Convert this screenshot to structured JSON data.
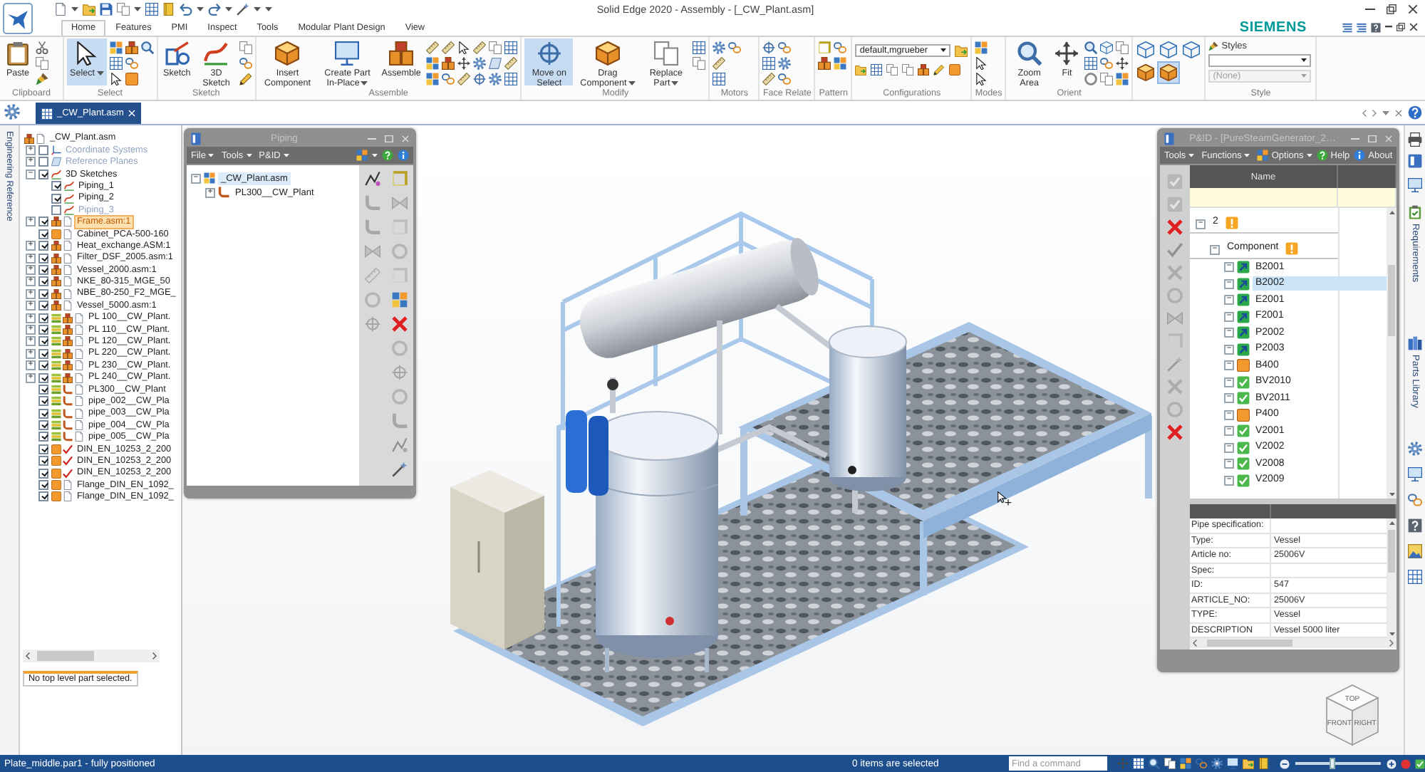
{
  "app": {
    "title": "Solid Edge 2020 - Assembly - [_CW_Plant.asm]",
    "brand": "SIEMENS"
  },
  "ribbon_tabs": [
    {
      "label": "Home",
      "selected": true
    },
    {
      "label": "Features",
      "selected": false
    },
    {
      "label": "PMI",
      "selected": false
    },
    {
      "label": "Inspect",
      "selected": false
    },
    {
      "label": "Tools",
      "selected": false
    },
    {
      "label": "Modular Plant Design",
      "selected": false
    },
    {
      "label": "View",
      "selected": false
    }
  ],
  "ribbon_groups": [
    {
      "kind": "clipboard",
      "label": "Clipboard",
      "commands": [
        {
          "label": "Paste",
          "selected": false,
          "dropdown": false
        }
      ]
    },
    {
      "kind": "select",
      "label": "Select",
      "commands": [
        {
          "label": "Select",
          "selected": true,
          "dropdown": true
        }
      ]
    },
    {
      "kind": "sketch",
      "label": "Sketch",
      "commands": [
        {
          "label": "Sketch",
          "selected": false,
          "dropdown": false
        },
        {
          "label": "3D Sketch",
          "selected": false,
          "dropdown": false
        }
      ]
    },
    {
      "kind": "assemble",
      "label": "Assemble",
      "commands": [
        {
          "label": "Insert Component",
          "selected": false,
          "dropdown": false
        },
        {
          "label": "Create Part In-Place",
          "selected": false,
          "dropdown": true
        },
        {
          "label": "Assemble",
          "selected": false,
          "dropdown": false
        }
      ]
    },
    {
      "kind": "modify",
      "label": "Modify",
      "commands": [
        {
          "label": "Move on Select",
          "selected": true,
          "dropdown": false
        },
        {
          "label": "Drag Component",
          "selected": false,
          "dropdown": true
        },
        {
          "label": "Replace Part",
          "selected": false,
          "dropdown": true
        }
      ]
    },
    {
      "kind": "motors",
      "label": "Motors"
    },
    {
      "kind": "relate",
      "label": "Face Relate"
    },
    {
      "kind": "pattern",
      "label": "Pattern"
    },
    {
      "kind": "configurations",
      "label": "Configurations",
      "dropdowns": [
        {
          "value": "default,mgrueber",
          "disabled": false
        }
      ]
    },
    {
      "kind": "modes",
      "label": "Modes"
    },
    {
      "kind": "orient",
      "label": "Orient",
      "commands": [
        {
          "label": "Zoom Area",
          "selected": false,
          "dropdown": false
        },
        {
          "label": "Fit",
          "selected": false,
          "dropdown": false
        }
      ]
    },
    {
      "kind": "views",
      "styles": [
        {
          "selected": false
        },
        {
          "selected": false
        },
        {
          "selected": false
        },
        {
          "selected": false
        },
        {
          "selected": true
        }
      ]
    },
    {
      "kind": "style",
      "label": "Style",
      "heading": "Styles",
      "dropdowns": [
        {
          "disabled": false
        },
        {
          "value": "(None)",
          "disabled": true
        }
      ]
    }
  ],
  "document_tabs": [
    {
      "label": "_CW_Plant.asm",
      "selected": true
    }
  ],
  "side_tabs_left": [
    {
      "label": "Engineering Reference",
      "selected": false
    }
  ],
  "assembly_tree": {
    "root": {
      "label": "_CW_Plant.asm",
      "kind": "assembly",
      "children": [
        {
          "label": "Coordinate Systems",
          "kind": "coordinates",
          "toggle": "+",
          "checked": false,
          "selected": false
        },
        {
          "label": "Reference Planes",
          "kind": "planes",
          "toggle": "+",
          "checked": false,
          "selected": false
        },
        {
          "label": "3D Sketches",
          "kind": "sketches",
          "toggle": "−",
          "checked": true,
          "selected": false,
          "children": [
            {
              "label": "Piping_1",
              "kind": "sketch",
              "checked": true,
              "selected": false
            },
            {
              "label": "Piping_2",
              "kind": "sketch",
              "checked": true,
              "selected": false
            },
            {
              "label": "Piping_3",
              "kind": "sketch",
              "checked": false,
              "selected": false
            }
          ]
        },
        {
          "label": "Frame.asm:1",
          "kind": "assembly",
          "toggle": "+",
          "checked": true,
          "selected": true
        },
        {
          "label": "Cabinet_PCA-500-160",
          "kind": "part",
          "checked": true,
          "selected": false
        },
        {
          "label": "Heat_exchange.ASM:1",
          "kind": "assembly",
          "toggle": "+",
          "checked": true,
          "selected": false
        },
        {
          "label": "Filter_DSF_2005.asm:1",
          "kind": "assembly",
          "toggle": "+",
          "checked": true,
          "selected": false
        },
        {
          "label": "Vessel_2000.asm:1",
          "kind": "assembly",
          "toggle": "+",
          "checked": true,
          "selected": false
        },
        {
          "label": "NKE_80-315_MGE_50",
          "kind": "assembly",
          "toggle": "+",
          "checked": true,
          "selected": false
        },
        {
          "label": "NBE_80-250_F2_MGE_",
          "kind": "assembly",
          "toggle": "+",
          "checked": true,
          "selected": false
        },
        {
          "label": "Vessel_5000.asm:1",
          "kind": "assembly",
          "toggle": "+",
          "checked": true,
          "selected": false
        },
        {
          "label": "PL 100__CW_Plant.",
          "kind": "pipeline",
          "toggle": "+",
          "checked": true,
          "selected": false
        },
        {
          "label": "PL 110__CW_Plant.",
          "kind": "pipeline",
          "toggle": "+",
          "checked": true,
          "selected": false
        },
        {
          "label": "PL 120__CW_Plant.",
          "kind": "pipeline",
          "toggle": "+",
          "checked": true,
          "selected": false
        },
        {
          "label": "PL 220__CW_Plant.",
          "kind": "pipeline",
          "toggle": "+",
          "checked": true,
          "selected": false
        },
        {
          "label": "PL 230__CW_Plant.",
          "kind": "pipeline",
          "toggle": "+",
          "checked": true,
          "selected": false
        },
        {
          "label": "PL 240__CW_Plant.",
          "kind": "pipeline",
          "toggle": "+",
          "checked": true,
          "selected": false
        },
        {
          "label": "PL300__CW_Plant",
          "kind": "route",
          "checked": true,
          "selected": false
        },
        {
          "label": "pipe_002__CW_Pla",
          "kind": "route",
          "checked": true,
          "selected": false
        },
        {
          "label": "pipe_003__CW_Pla",
          "kind": "route",
          "checked": true,
          "selected": false
        },
        {
          "label": "pipe_004__CW_Pla",
          "kind": "route",
          "checked": true,
          "selected": false
        },
        {
          "label": "pipe_005__CW_Pla",
          "kind": "route",
          "checked": true,
          "selected": false
        },
        {
          "label": "DIN_EN_10253_2_200",
          "kind": "fitting",
          "checked": true,
          "selected": false
        },
        {
          "label": "DIN_EN_10253_2_200",
          "kind": "fitting",
          "checked": true,
          "selected": false
        },
        {
          "label": "DIN_EN_10253_2_200",
          "kind": "fitting",
          "checked": true,
          "selected": false
        },
        {
          "label": "Flange_DIN_EN_1092_",
          "kind": "part",
          "checked": true,
          "selected": false
        },
        {
          "label": "Flange_DIN_EN_1092_",
          "kind": "part",
          "checked": true,
          "selected": false
        }
      ]
    },
    "status": "No top level part selected."
  },
  "piping_panel": {
    "title": "Piping",
    "menus": [
      "File",
      "Tools",
      "P&ID"
    ],
    "tree": [
      {
        "label": "_CW_Plant.asm",
        "kind": "assembly",
        "toggle": "−",
        "selected": true,
        "children": [
          {
            "label": "PL300__CW_Plant",
            "kind": "pipeline",
            "toggle": "+",
            "selected": false
          }
        ]
      }
    ]
  },
  "pid_panel": {
    "title": "P&ID - [PureSteamGenerator_2…",
    "menus": [
      "Tools",
      "Functions"
    ],
    "actions": [
      "Options",
      "Help",
      "About"
    ],
    "column": "Name",
    "tree": [
      {
        "label": "2",
        "kind": "group",
        "toggle": "−",
        "selected": false,
        "children": [
          {
            "label": "Component",
            "kind": "group",
            "toggle": "−",
            "selected": false,
            "children": [
              {
                "label": "B2001",
                "kind": "linked",
                "toggle": "−",
                "selected": false
              },
              {
                "label": "B2002",
                "kind": "linked",
                "toggle": "−",
                "selected": true
              },
              {
                "label": "E2001",
                "kind": "linked",
                "toggle": "−",
                "selected": false
              },
              {
                "label": "F2001",
                "kind": "linked",
                "toggle": "−",
                "selected": false
              },
              {
                "label": "P2002",
                "kind": "linked",
                "toggle": "−",
                "selected": false
              },
              {
                "label": "P2003",
                "kind": "linked",
                "toggle": "−",
                "selected": false
              },
              {
                "label": "B400",
                "kind": "unplaced",
                "toggle": "−",
                "selected": false
              },
              {
                "label": "BV2010",
                "kind": "placed",
                "toggle": "−",
                "selected": false
              },
              {
                "label": "BV2011",
                "kind": "placed",
                "toggle": "−",
                "selected": false
              },
              {
                "label": "P400",
                "kind": "unplaced",
                "toggle": "−",
                "selected": false
              },
              {
                "label": "V2001",
                "kind": "placed",
                "toggle": "−",
                "selected": false
              },
              {
                "label": "V2002",
                "kind": "placed",
                "toggle": "−",
                "selected": false
              },
              {
                "label": "V2008",
                "kind": "placed",
                "toggle": "−",
                "selected": false
              },
              {
                "label": "V2009",
                "kind": "placed",
                "toggle": "−",
                "selected": false
              }
            ]
          }
        ]
      }
    ],
    "properties": [
      {
        "name": "Pipe specification:"
      },
      {
        "name": "Type:",
        "value": "Vessel"
      },
      {
        "name": "Article no:",
        "value": "25006V"
      },
      {
        "name": "Spec:"
      },
      {
        "name": "ID:",
        "value": "547"
      },
      {
        "name": "ARTICLE_NO:",
        "value": "25006V"
      },
      {
        "name": "TYPE:",
        "value": "Vessel"
      },
      {
        "name": "DESCRIPTION",
        "value": "Vessel 5000 liter"
      }
    ]
  },
  "view_cube": {
    "faces": [
      "TOP",
      "FRONT",
      "RIGHT"
    ]
  },
  "side_tabs_right": [
    {
      "label": "Requirements",
      "selected": false
    },
    {
      "label": "Parts Library",
      "selected": false
    }
  ],
  "status_bar": {
    "message": "Plate_middle.par1 - fully positioned",
    "selection": "0 items are selected",
    "command_search": {
      "placeholder": "Find a command"
    },
    "zoom": {
      "level": 0.42
    }
  }
}
